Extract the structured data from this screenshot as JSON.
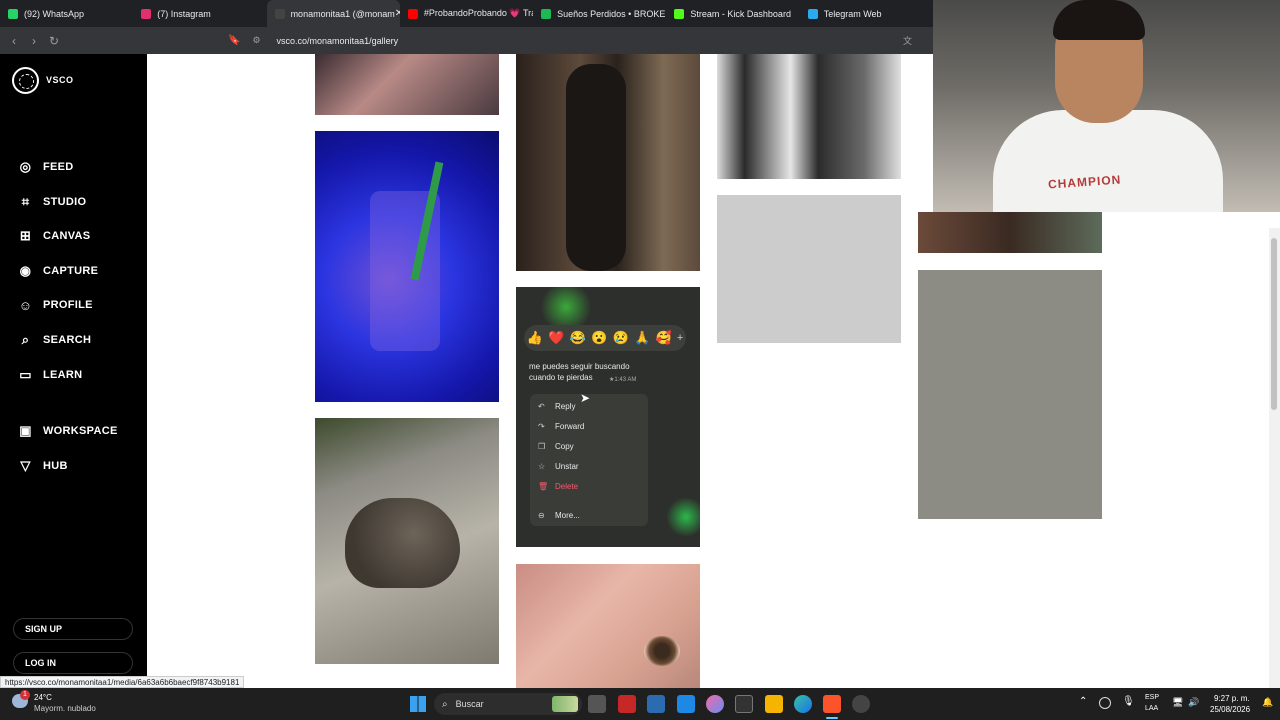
{
  "browser": {
    "tabs": [
      {
        "label": "(92) WhatsApp",
        "icon": "whatsapp-icon",
        "color": "#25d366"
      },
      {
        "label": "(7) Instagram",
        "icon": "instagram-icon",
        "color": "#e1306c"
      },
      {
        "label": "monamonitaa1 (@monam",
        "icon": "vsco-icon",
        "color": "#444444",
        "active": true
      },
      {
        "label": "#ProbandoProbando 💗 Tras",
        "icon": "youtube-icon",
        "color": "#ff0000"
      },
      {
        "label": "Sueños Perdidos • BROKEN",
        "icon": "spotify-icon",
        "color": "#1db954"
      },
      {
        "label": "Stream - Kick Dashboard",
        "icon": "kick-icon",
        "color": "#53fc18"
      },
      {
        "label": "Telegram Web",
        "icon": "telegram-icon",
        "color": "#2aabee"
      }
    ],
    "url": "vsco.co/monamonitaa1/gallery",
    "status_url": "https://vsco.co/monamonitaa1/media/6a63a6b6baecf9f8743b9181"
  },
  "sidebar": {
    "brand": "VSCO",
    "nav": [
      {
        "label": "FEED",
        "icon": "globe-icon"
      },
      {
        "label": "STUDIO",
        "icon": "crop-icon"
      },
      {
        "label": "CANVAS",
        "icon": "canvas-icon"
      },
      {
        "label": "CAPTURE",
        "icon": "camera-icon"
      },
      {
        "label": "PROFILE",
        "icon": "profile-icon"
      },
      {
        "label": "SEARCH",
        "icon": "search-icon"
      },
      {
        "label": "LEARN",
        "icon": "book-icon"
      }
    ],
    "nav2": [
      {
        "label": "WORKSPACE",
        "icon": "workspace-icon"
      },
      {
        "label": "HUB",
        "icon": "hub-icon"
      }
    ],
    "signup": "SIGN UP",
    "login": "LOG IN"
  },
  "chat": {
    "emojis": [
      "👍",
      "❤️",
      "😂",
      "😮",
      "😢",
      "🙏",
      "🥰",
      "+"
    ],
    "message": "me puedes seguir buscando cuando te pierdas",
    "time": "★1:43 AM",
    "menu": [
      {
        "label": "Reply",
        "icon": "reply-icon"
      },
      {
        "label": "Forward",
        "icon": "forward-icon"
      },
      {
        "label": "Copy",
        "icon": "copy-icon"
      },
      {
        "label": "Unstar",
        "icon": "star-icon"
      },
      {
        "label": "Delete",
        "icon": "trash-icon",
        "color": "#f15c6d"
      },
      {
        "label": "More...",
        "icon": "more-icon"
      }
    ]
  },
  "webcam": {
    "shirt_text": "CHAMPION"
  },
  "taskbar": {
    "weather_temp": "24°C",
    "weather_desc": "Mayorm. nublado",
    "weather_badge": "1",
    "search": "Buscar",
    "lang1": "ESP",
    "lang2": "LAA",
    "time": "9:27 p. m.",
    "date": "25/08/2026"
  }
}
